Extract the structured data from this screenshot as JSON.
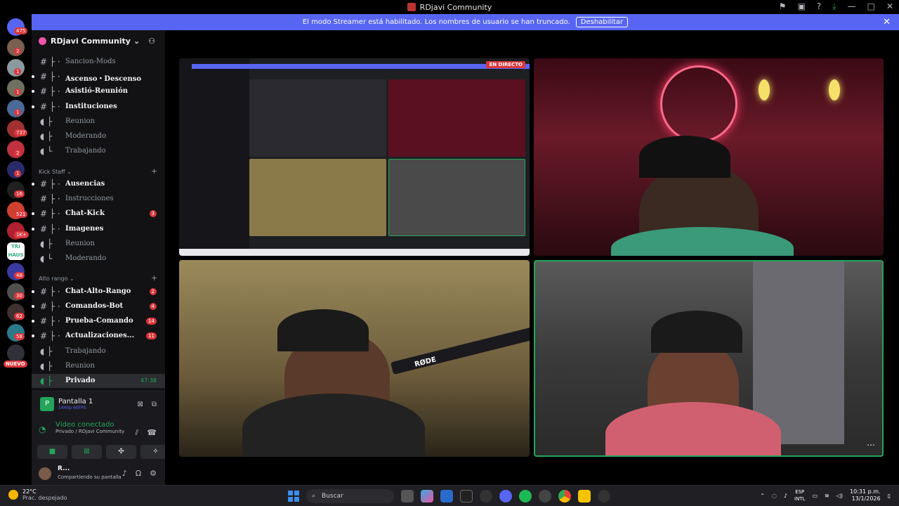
{
  "window": {
    "title": "RDjavi Community",
    "controls": [
      "—",
      "□",
      "✕"
    ]
  },
  "streamer_bar": {
    "message": "El modo Streamer está habilitado. Los nombres de usuario se han truncado.",
    "button": "Deshabilitar"
  },
  "guild_badges": [
    "475",
    "2",
    "1",
    "1",
    "1",
    "737",
    "2",
    "1",
    "16",
    "521",
    "1K+",
    "48",
    "30",
    "62",
    "58"
  ],
  "nuevo_label": "NUEVO",
  "tri_haus": "TRI HAUS",
  "server": {
    "name": "RDjavi Community"
  },
  "channels_top": [
    {
      "name": "Sancion-Mods",
      "bold": false
    },
    {
      "name": "Ascenso・Descenso",
      "bold": true
    },
    {
      "name": "Asistió-Reunión",
      "bold": true
    },
    {
      "name": "Instituciones",
      "bold": true
    },
    {
      "name": "Reunion",
      "bold": false
    },
    {
      "name": "Moderando",
      "bold": false
    },
    {
      "name": "Trabajando",
      "bold": false
    }
  ],
  "category_kick": "Kick Staff",
  "channels_kick": [
    {
      "name": "Ausencias",
      "bold": true,
      "badge": ""
    },
    {
      "name": "Instrucciones",
      "bold": false,
      "badge": ""
    },
    {
      "name": "Chat-Kick",
      "bold": true,
      "badge": "3"
    },
    {
      "name": "Imagenes",
      "bold": true,
      "badge": ""
    },
    {
      "name": "Reunion",
      "bold": false,
      "badge": ""
    },
    {
      "name": "Moderando",
      "bold": false,
      "badge": ""
    }
  ],
  "category_alto": "Alto rango",
  "channels_alto": [
    {
      "name": "Chat-Alto-Rango",
      "bold": true,
      "badge": "2"
    },
    {
      "name": "Comandos-Bot",
      "bold": true,
      "badge": "4"
    },
    {
      "name": "Prueba-Comando",
      "bold": true,
      "badge": "14"
    },
    {
      "name": "Actualizaciones...",
      "bold": true,
      "badge": "11"
    },
    {
      "name": "Trabajando",
      "bold": false,
      "badge": ""
    },
    {
      "name": "Reunion",
      "bold": false,
      "badge": ""
    },
    {
      "name": "Privado",
      "bold": true,
      "badge": ""
    }
  ],
  "active_channel_time": "47:38",
  "screen_share": {
    "title": "Pantalla 1",
    "quality": "1440p 60FPS"
  },
  "voice": {
    "status": "Vídeo conectado",
    "location": "Privado / RDjavi Community"
  },
  "user": {
    "name": "R...",
    "status": "Compartiendo su pantalla"
  },
  "stage": {
    "live_label": "EN DIRECTO",
    "mic_brand": "RØDE"
  },
  "taskbar": {
    "weather_temp": "22°C",
    "weather_desc": "Prac. despejado",
    "search": "Buscar",
    "lang1": "ESP",
    "lang2": "INTL",
    "time": "10:31 p.m.",
    "date": "13/1/2026"
  },
  "colors": {
    "blurple": "#5865f2",
    "green": "#23a55a",
    "red": "#da373c"
  }
}
